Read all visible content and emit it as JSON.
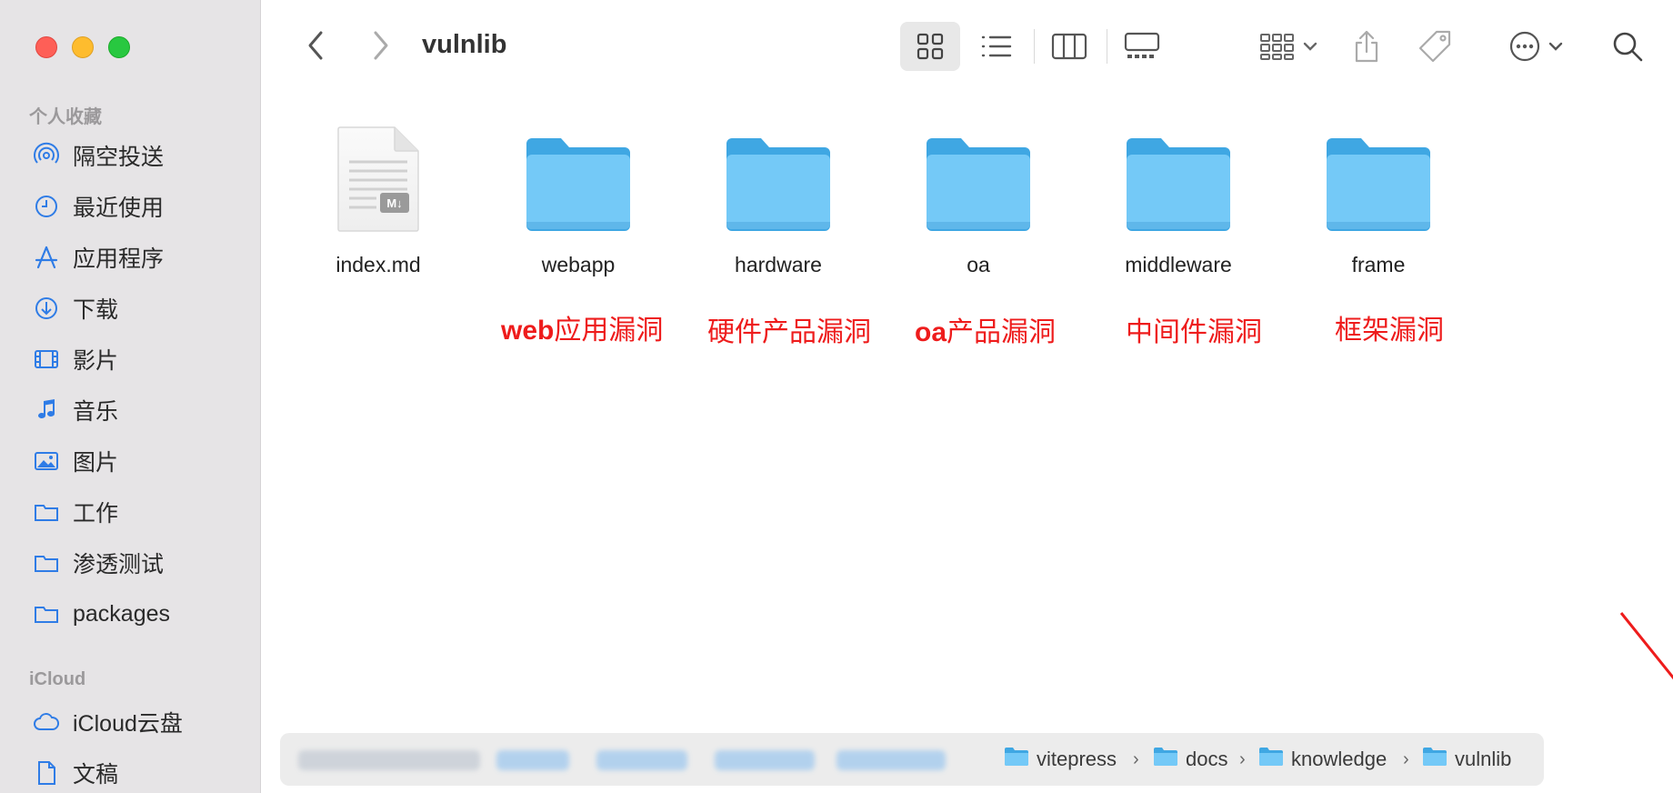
{
  "window": {
    "title": "vulnlib"
  },
  "sidebar": {
    "favorites_title": "个人收藏",
    "favorites": [
      {
        "label": "隔空投送",
        "icon": "airdrop-icon"
      },
      {
        "label": "最近使用",
        "icon": "clock-icon"
      },
      {
        "label": "应用程序",
        "icon": "applications-icon"
      },
      {
        "label": "下载",
        "icon": "download-icon"
      },
      {
        "label": "影片",
        "icon": "film-icon"
      },
      {
        "label": "音乐",
        "icon": "music-icon"
      },
      {
        "label": "图片",
        "icon": "photo-icon"
      },
      {
        "label": "工作",
        "icon": "folder-icon"
      },
      {
        "label": "渗透测试",
        "icon": "folder-icon"
      },
      {
        "label": "packages",
        "icon": "folder-icon"
      }
    ],
    "icloud_title": "iCloud",
    "icloud": [
      {
        "label": "iCloud云盘",
        "icon": "cloud-icon"
      },
      {
        "label": "文稿",
        "icon": "document-icon"
      }
    ]
  },
  "toolbar": {
    "back_icon": "chevron-left-icon",
    "forward_icon": "chevron-right-icon",
    "view_modes": [
      "icon-view",
      "list-view",
      "column-view",
      "gallery-view"
    ],
    "active_view": "icon-view"
  },
  "files": [
    {
      "name": "index.md",
      "type": "markdown",
      "icon": "markdown-file-icon"
    },
    {
      "name": "webapp",
      "type": "folder",
      "icon": "folder-icon"
    },
    {
      "name": "hardware",
      "type": "folder",
      "icon": "folder-icon"
    },
    {
      "name": "oa",
      "type": "folder",
      "icon": "folder-icon"
    },
    {
      "name": "middleware",
      "type": "folder",
      "icon": "folder-icon"
    },
    {
      "name": "frame",
      "type": "folder",
      "icon": "folder-icon"
    }
  ],
  "annotations": [
    {
      "prefix": "web",
      "text": "应用漏洞"
    },
    {
      "prefix": "",
      "text": "硬件产品漏洞"
    },
    {
      "prefix": "oa",
      "text": "产品漏洞"
    },
    {
      "prefix": "",
      "text": "中间件漏洞"
    },
    {
      "prefix": "",
      "text": "框架漏洞"
    }
  ],
  "pathbar": {
    "crumbs": [
      "vitepress",
      "docs",
      "knowledge",
      "vulnlib"
    ]
  },
  "colors": {
    "folder_light": "#74c9f7",
    "folder_dark": "#3fa7e3",
    "annotation_red": "#ee1c1c",
    "sidebar_icon_blue": "#2f7ce6"
  }
}
